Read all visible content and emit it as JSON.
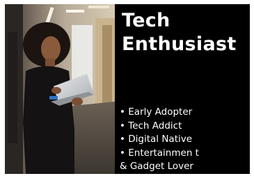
{
  "title_line1": "Tech",
  "title_line2": "Enthusiast",
  "bullets": [
    "• Early Adopter",
    "• Tech Addict",
    "• Digital Native",
    "• Entertainmen t",
    "& Gadget Lover"
  ],
  "colors": {
    "panel_background": "#000000",
    "text": "#ffffff"
  }
}
